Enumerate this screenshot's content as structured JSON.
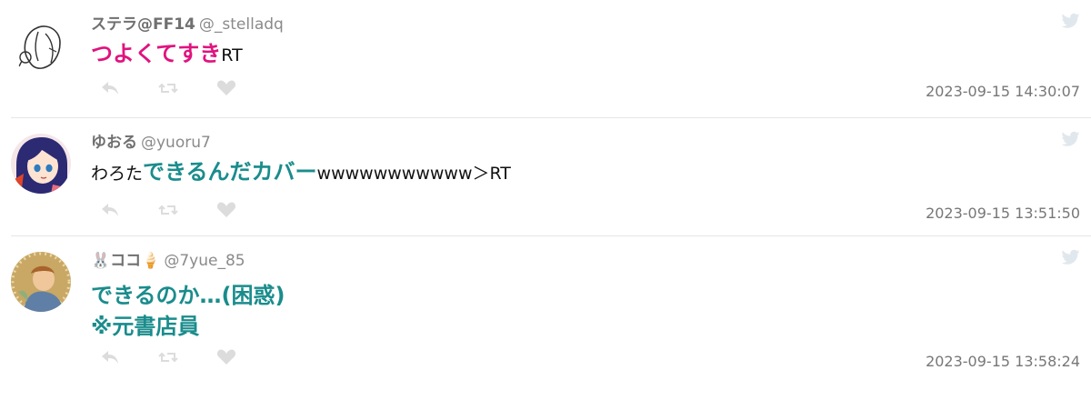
{
  "tweets": [
    {
      "name": "ステラ@FF14",
      "handle": "@_stelladq",
      "highlight": "つよくてすき",
      "suffix": "RT",
      "timestamp": "2023-09-15 14:30:07",
      "highlight_color": "#e0137e"
    },
    {
      "name": "ゆおる",
      "handle": "@yuoru7",
      "prefix": "わろた",
      "highlight": "できるんだカバー",
      "suffix": "wwwwwwwwwww＞RT",
      "timestamp": "2023-09-15 13:51:50",
      "highlight_color": "#1a8c8c"
    },
    {
      "name_prefix_emoji": "🐰",
      "name": "ココ",
      "name_suffix_emoji": "🍦",
      "handle": "@7yue_85",
      "line1": "できるのか…(困惑)",
      "line2": "※元書店員",
      "timestamp": "2023-09-15 13:58:24",
      "highlight_color": "#1a8c8c"
    }
  ],
  "icons": {
    "reply": "reply-icon",
    "retweet": "retweet-icon",
    "like": "heart-icon",
    "brand": "twitter-bird-icon"
  }
}
